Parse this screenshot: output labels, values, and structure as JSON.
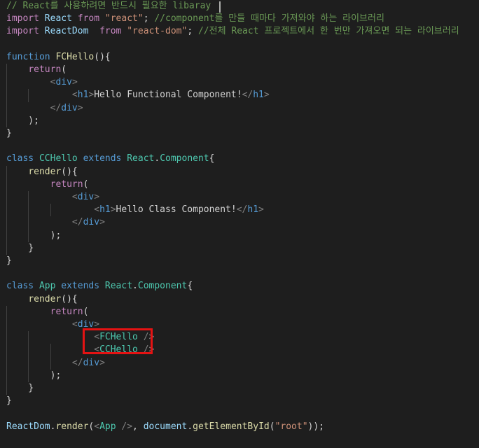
{
  "colors": {
    "background": "#1e1e1e",
    "comment": "#6a9955",
    "keyword_import": "#c586c0",
    "keyword": "#569cd6",
    "identifier": "#9cdcfe",
    "function": "#dcdcaa",
    "class_name": "#4ec9b0",
    "string": "#ce9178",
    "punctuation": "#d4d4d4",
    "tag_bracket": "#808080",
    "jsx_component": "#4ec9b0",
    "highlight_border": "#e41313"
  },
  "code": {
    "lines": [
      {
        "tokens": [
          {
            "t": "// React를 사용하려면 반드시 필요한 libaray",
            "k": "comment"
          }
        ]
      },
      {
        "tokens": [
          {
            "t": "import",
            "k": "keyword_import"
          },
          {
            "t": " ",
            "k": "punctuation"
          },
          {
            "t": "React",
            "k": "identifier"
          },
          {
            "t": " ",
            "k": "punctuation"
          },
          {
            "t": "from",
            "k": "keyword_import"
          },
          {
            "t": " ",
            "k": "punctuation"
          },
          {
            "t": "\"react\"",
            "k": "string"
          },
          {
            "t": "; ",
            "k": "punctuation"
          },
          {
            "t": "//component를 만들 때마다 가져와야 하는 라이브러리",
            "k": "comment"
          }
        ]
      },
      {
        "tokens": [
          {
            "t": "import",
            "k": "keyword_import"
          },
          {
            "t": " ",
            "k": "punctuation"
          },
          {
            "t": "ReactDom",
            "k": "identifier"
          },
          {
            "t": "  ",
            "k": "punctuation"
          },
          {
            "t": "from",
            "k": "keyword_import"
          },
          {
            "t": " ",
            "k": "punctuation"
          },
          {
            "t": "\"react-dom\"",
            "k": "string"
          },
          {
            "t": "; ",
            "k": "punctuation"
          },
          {
            "t": "//전체 React 프로젝트에서 한 번만 가져오면 되는 라이브러리",
            "k": "comment"
          }
        ]
      },
      {
        "tokens": []
      },
      {
        "tokens": [
          {
            "t": "function",
            "k": "keyword"
          },
          {
            "t": " ",
            "k": "punctuation"
          },
          {
            "t": "FCHello",
            "k": "function"
          },
          {
            "t": "(){",
            "k": "punctuation"
          }
        ]
      },
      {
        "tokens": [
          {
            "t": "    ",
            "k": "punctuation"
          },
          {
            "t": "return",
            "k": "keyword_import"
          },
          {
            "t": "(",
            "k": "punctuation"
          }
        ]
      },
      {
        "tokens": [
          {
            "t": "        ",
            "k": "punctuation"
          },
          {
            "t": "<",
            "k": "tag_bracket"
          },
          {
            "t": "div",
            "k": "keyword"
          },
          {
            "t": ">",
            "k": "tag_bracket"
          }
        ]
      },
      {
        "tokens": [
          {
            "t": "            ",
            "k": "punctuation"
          },
          {
            "t": "<",
            "k": "tag_bracket"
          },
          {
            "t": "h1",
            "k": "keyword"
          },
          {
            "t": ">",
            "k": "tag_bracket"
          },
          {
            "t": "Hello Functional Component!",
            "k": "punctuation"
          },
          {
            "t": "</",
            "k": "tag_bracket"
          },
          {
            "t": "h1",
            "k": "keyword"
          },
          {
            "t": ">",
            "k": "tag_bracket"
          }
        ]
      },
      {
        "tokens": [
          {
            "t": "        ",
            "k": "punctuation"
          },
          {
            "t": "</",
            "k": "tag_bracket"
          },
          {
            "t": "div",
            "k": "keyword"
          },
          {
            "t": ">",
            "k": "tag_bracket"
          }
        ]
      },
      {
        "tokens": [
          {
            "t": "    );",
            "k": "punctuation"
          }
        ]
      },
      {
        "tokens": [
          {
            "t": "}",
            "k": "punctuation"
          }
        ]
      },
      {
        "tokens": []
      },
      {
        "tokens": [
          {
            "t": "class",
            "k": "keyword"
          },
          {
            "t": " ",
            "k": "punctuation"
          },
          {
            "t": "CCHello",
            "k": "class_name"
          },
          {
            "t": " ",
            "k": "punctuation"
          },
          {
            "t": "extends",
            "k": "keyword"
          },
          {
            "t": " ",
            "k": "punctuation"
          },
          {
            "t": "React",
            "k": "class_name"
          },
          {
            "t": ".",
            "k": "punctuation"
          },
          {
            "t": "Component",
            "k": "class_name"
          },
          {
            "t": "{",
            "k": "punctuation"
          }
        ]
      },
      {
        "tokens": [
          {
            "t": "    ",
            "k": "punctuation"
          },
          {
            "t": "render",
            "k": "function"
          },
          {
            "t": "(){",
            "k": "punctuation"
          }
        ]
      },
      {
        "tokens": [
          {
            "t": "        ",
            "k": "punctuation"
          },
          {
            "t": "return",
            "k": "keyword_import"
          },
          {
            "t": "(",
            "k": "punctuation"
          }
        ]
      },
      {
        "tokens": [
          {
            "t": "            ",
            "k": "punctuation"
          },
          {
            "t": "<",
            "k": "tag_bracket"
          },
          {
            "t": "div",
            "k": "keyword"
          },
          {
            "t": ">",
            "k": "tag_bracket"
          }
        ]
      },
      {
        "tokens": [
          {
            "t": "                ",
            "k": "punctuation"
          },
          {
            "t": "<",
            "k": "tag_bracket"
          },
          {
            "t": "h1",
            "k": "keyword"
          },
          {
            "t": ">",
            "k": "tag_bracket"
          },
          {
            "t": "Hello Class Component!",
            "k": "punctuation"
          },
          {
            "t": "</",
            "k": "tag_bracket"
          },
          {
            "t": "h1",
            "k": "keyword"
          },
          {
            "t": ">",
            "k": "tag_bracket"
          }
        ]
      },
      {
        "tokens": [
          {
            "t": "            ",
            "k": "punctuation"
          },
          {
            "t": "</",
            "k": "tag_bracket"
          },
          {
            "t": "div",
            "k": "keyword"
          },
          {
            "t": ">",
            "k": "tag_bracket"
          }
        ]
      },
      {
        "tokens": [
          {
            "t": "        );",
            "k": "punctuation"
          }
        ]
      },
      {
        "tokens": [
          {
            "t": "    }",
            "k": "punctuation"
          }
        ]
      },
      {
        "tokens": [
          {
            "t": "}",
            "k": "punctuation"
          }
        ]
      },
      {
        "tokens": []
      },
      {
        "tokens": [
          {
            "t": "class",
            "k": "keyword"
          },
          {
            "t": " ",
            "k": "punctuation"
          },
          {
            "t": "App",
            "k": "class_name"
          },
          {
            "t": " ",
            "k": "punctuation"
          },
          {
            "t": "extends",
            "k": "keyword"
          },
          {
            "t": " ",
            "k": "punctuation"
          },
          {
            "t": "React",
            "k": "class_name"
          },
          {
            "t": ".",
            "k": "punctuation"
          },
          {
            "t": "Component",
            "k": "class_name"
          },
          {
            "t": "{",
            "k": "punctuation"
          }
        ]
      },
      {
        "tokens": [
          {
            "t": "    ",
            "k": "punctuation"
          },
          {
            "t": "render",
            "k": "function"
          },
          {
            "t": "(){",
            "k": "punctuation"
          }
        ]
      },
      {
        "tokens": [
          {
            "t": "        ",
            "k": "punctuation"
          },
          {
            "t": "return",
            "k": "keyword_import"
          },
          {
            "t": "(",
            "k": "punctuation"
          }
        ]
      },
      {
        "tokens": [
          {
            "t": "            ",
            "k": "punctuation"
          },
          {
            "t": "<",
            "k": "tag_bracket"
          },
          {
            "t": "div",
            "k": "keyword"
          },
          {
            "t": ">",
            "k": "tag_bracket"
          }
        ]
      },
      {
        "tokens": [
          {
            "t": "                ",
            "k": "punctuation"
          },
          {
            "t": "<",
            "k": "tag_bracket"
          },
          {
            "t": "FCHello",
            "k": "jsx_component"
          },
          {
            "t": " ",
            "k": "punctuation"
          },
          {
            "t": "/>",
            "k": "tag_bracket"
          }
        ]
      },
      {
        "tokens": [
          {
            "t": "                ",
            "k": "punctuation"
          },
          {
            "t": "<",
            "k": "tag_bracket"
          },
          {
            "t": "CCHello",
            "k": "jsx_component"
          },
          {
            "t": " ",
            "k": "punctuation"
          },
          {
            "t": "/>",
            "k": "tag_bracket"
          }
        ]
      },
      {
        "tokens": [
          {
            "t": "            ",
            "k": "punctuation"
          },
          {
            "t": "</",
            "k": "tag_bracket"
          },
          {
            "t": "div",
            "k": "keyword"
          },
          {
            "t": ">",
            "k": "tag_bracket"
          }
        ]
      },
      {
        "tokens": [
          {
            "t": "        );",
            "k": "punctuation"
          }
        ]
      },
      {
        "tokens": [
          {
            "t": "    }",
            "k": "punctuation"
          }
        ]
      },
      {
        "tokens": [
          {
            "t": "}",
            "k": "punctuation"
          }
        ]
      },
      {
        "tokens": []
      },
      {
        "tokens": [
          {
            "t": "ReactDom",
            "k": "identifier"
          },
          {
            "t": ".",
            "k": "punctuation"
          },
          {
            "t": "render",
            "k": "function"
          },
          {
            "t": "(",
            "k": "punctuation"
          },
          {
            "t": "<",
            "k": "tag_bracket"
          },
          {
            "t": "App",
            "k": "jsx_component"
          },
          {
            "t": " ",
            "k": "punctuation"
          },
          {
            "t": "/>",
            "k": "tag_bracket"
          },
          {
            "t": ", ",
            "k": "punctuation"
          },
          {
            "t": "document",
            "k": "identifier"
          },
          {
            "t": ".",
            "k": "punctuation"
          },
          {
            "t": "getElementById",
            "k": "function"
          },
          {
            "t": "(",
            "k": "punctuation"
          },
          {
            "t": "\"root\"",
            "k": "string"
          },
          {
            "t": "));",
            "k": "punctuation"
          }
        ]
      }
    ]
  }
}
